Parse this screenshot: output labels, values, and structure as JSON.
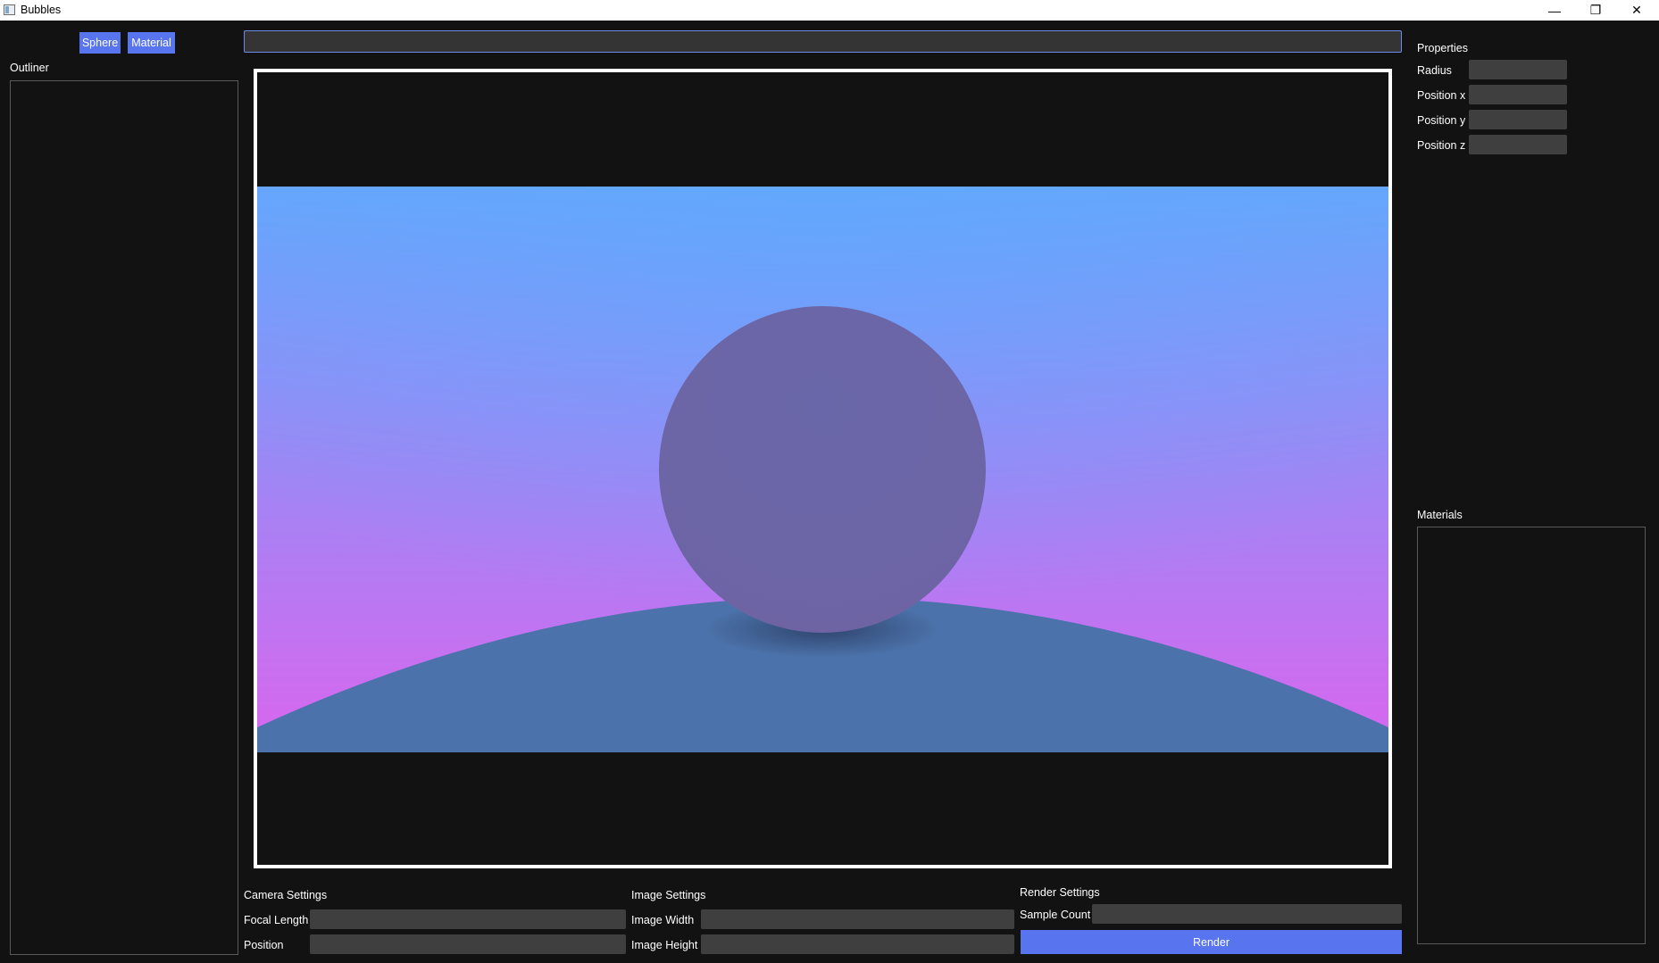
{
  "window": {
    "title": "Bubbles",
    "controls": {
      "minimize": "—",
      "maximize": "❐",
      "close": "✕"
    }
  },
  "toolbar": {
    "sphere_label": "Sphere",
    "material_label": "Material"
  },
  "outliner": {
    "title": "Outliner"
  },
  "search": {
    "value": ""
  },
  "properties": {
    "title": "Properties",
    "fields": [
      {
        "label": "Radius",
        "value": ""
      },
      {
        "label": "Position x",
        "value": ""
      },
      {
        "label": "Position y",
        "value": ""
      },
      {
        "label": "Position z",
        "value": ""
      }
    ]
  },
  "materials": {
    "title": "Materials"
  },
  "camera_settings": {
    "title": "Camera Settings",
    "focal_length_label": "Focal Length",
    "position_label": "Position"
  },
  "image_settings": {
    "title": "Image Settings",
    "width_label": "Image Width",
    "height_label": "Image Height"
  },
  "render_settings": {
    "title": "Render Settings",
    "sample_count_label": "Sample Count",
    "render_label": "Render"
  },
  "colors": {
    "accent": "#5874ee",
    "background": "#121212",
    "field": "#3f3f3f",
    "sky_top": "#66a6fb",
    "sky_bottom": "#d966ee",
    "ground": "#4b72aa",
    "sphere": "#6e68a6"
  }
}
